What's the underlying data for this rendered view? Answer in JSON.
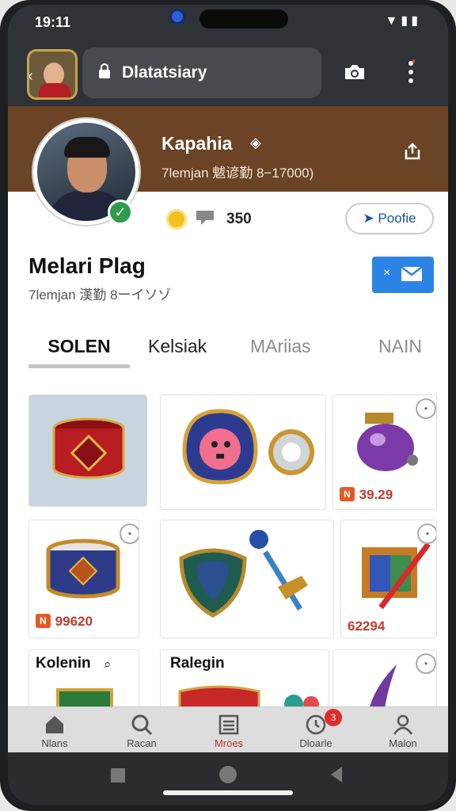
{
  "status": {
    "time": "19:11",
    "icons": "▼▮▮"
  },
  "browser": {
    "url": "Dlatatsiary"
  },
  "profile": {
    "banner_name": "Kapahia",
    "banner_sub": "7lemjan 魃谚勤 8−17000)",
    "stat_count": "350",
    "follow_label": "Poofie",
    "name": "Melari Plag",
    "subtitle": "7lemjan 漢勤 8ーイソゾ",
    "message_x": "×"
  },
  "tabs": [
    {
      "label": "SOLEN",
      "active": true
    },
    {
      "label": "Kelsiak",
      "active": false
    },
    {
      "label": "MAriias",
      "active": false
    },
    {
      "label": "NAIN",
      "active": false
    }
  ],
  "items": {
    "price_tag": "N",
    "item3_price": "39.29",
    "item4_price": "99620",
    "item6_price": "62294",
    "item7_label": "Kolenin",
    "item8_label": "Ralegin"
  },
  "bottom_nav": [
    {
      "label": "Nlans",
      "icon": "home-icon"
    },
    {
      "label": "Racan",
      "icon": "search-icon"
    },
    {
      "label": "Mroes",
      "icon": "list-icon",
      "active": true
    },
    {
      "label": "Dloarle",
      "icon": "clock-icon",
      "badge": "3"
    },
    {
      "label": "Malon",
      "icon": "person-icon"
    }
  ],
  "colors": {
    "banner": "#6a4425",
    "accent_blue": "#2b84e5",
    "active_nav": "#b6352d"
  }
}
